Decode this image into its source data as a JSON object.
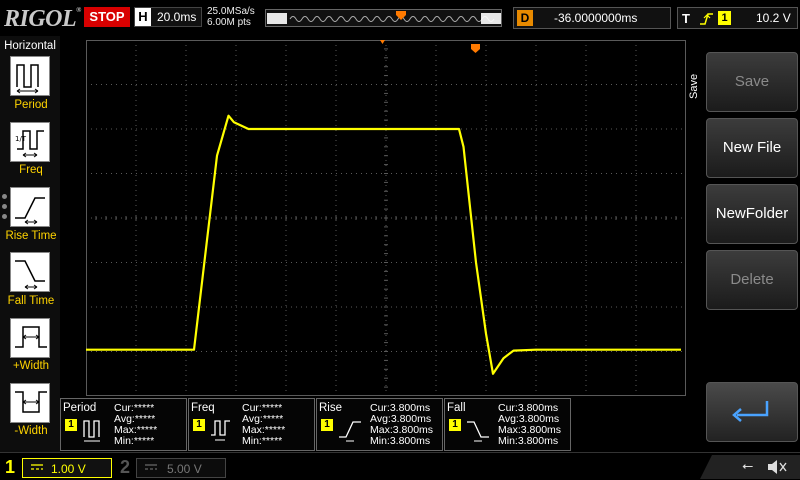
{
  "brand": "RIGOL",
  "brand_mark": "®",
  "run_state": "STOP",
  "horizontal": {
    "label": "H",
    "timebase": "20.0ms",
    "sample_rate": "25.0MSa/s",
    "memory_depth": "6.00M pts"
  },
  "delay": {
    "label": "D",
    "value": "-36.0000000ms"
  },
  "trigger": {
    "label": "T",
    "source": "1",
    "level": "10.2 V"
  },
  "left_menu": {
    "title": "Horizontal",
    "items": [
      {
        "label": "Period",
        "icon": "period-icon"
      },
      {
        "label": "Freq",
        "icon": "freq-icon"
      },
      {
        "label": "Rise Time",
        "icon": "rise-time-icon"
      },
      {
        "label": "Fall Time",
        "icon": "fall-time-icon"
      },
      {
        "label": "+Width",
        "icon": "plus-width-icon"
      },
      {
        "label": "-Width",
        "icon": "minus-width-icon"
      }
    ]
  },
  "measurements": [
    {
      "name": "Period",
      "source": "1",
      "cur": "Cur:*****",
      "avg": "Avg:*****",
      "max": "Max:*****",
      "min": "Min:*****"
    },
    {
      "name": "Freq",
      "source": "1",
      "cur": "Cur:*****",
      "avg": "Avg:*****",
      "max": "Max:*****",
      "min": "Min:*****"
    },
    {
      "name": "Rise",
      "source": "1",
      "cur": "Cur:3.800ms",
      "avg": "Avg:3.800ms",
      "max": "Max:3.800ms",
      "min": "Min:3.800ms"
    },
    {
      "name": "Fall",
      "source": "1",
      "cur": "Cur:3.800ms",
      "avg": "Avg:3.800ms",
      "max": "Max:3.800ms",
      "min": "Min:3.800ms"
    }
  ],
  "right_menu": {
    "tab": "Save",
    "buttons": [
      {
        "label": "Save",
        "enabled": false
      },
      {
        "label": "New File",
        "enabled": true
      },
      {
        "label": "NewFolder",
        "enabled": true
      },
      {
        "label": "Delete",
        "enabled": false
      },
      {
        "label": "",
        "icon": "enter-icon",
        "enabled": true
      }
    ]
  },
  "channels": [
    {
      "number": "1",
      "scale": "1.00 V",
      "coupling": "DC",
      "active": true
    },
    {
      "number": "2",
      "scale": "5.00 V",
      "coupling": "DC",
      "active": false
    }
  ],
  "colors": {
    "ch1": "#ffff00",
    "stop": "#d80000",
    "delay": "#e88a00",
    "grid": "#5a5a5a",
    "trigger_marker": "#ff7a00"
  },
  "chart_data": {
    "type": "line",
    "grid": {
      "divisions_x": 12,
      "divisions_y": 8
    },
    "series": [
      {
        "x_div": [
          0.0,
          1.5,
          2.16,
          2.62,
          2.85,
          2.96,
          3.25,
          7.46,
          7.55,
          7.8,
          8.0,
          8.14,
          8.35,
          8.55,
          9.0,
          11.9
        ],
        "y_div": [
          -2.96,
          -2.96,
          -2.96,
          1.4,
          2.3,
          2.15,
          2.0,
          2.0,
          1.6,
          -1.0,
          -2.6,
          -3.5,
          -3.15,
          -2.98,
          -2.96,
          -2.96
        ]
      }
    ]
  }
}
